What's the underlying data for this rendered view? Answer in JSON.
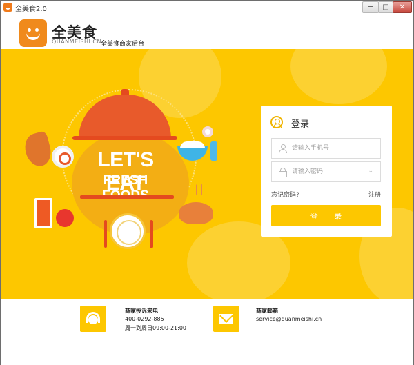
{
  "window": {
    "title": "全美食2.0",
    "min_label": "─",
    "max_label": "□",
    "close_label": "✕"
  },
  "header": {
    "logo_text": "全美食",
    "logo_sub": "QUANMEISHI.CN",
    "logo_desc": "全美食商家后台"
  },
  "banner": {
    "slogan_line1": "LET'S EAT",
    "slogan_line2": "FRESH FOODS",
    "background_color": "#fdc700"
  },
  "login": {
    "title": "登录",
    "phone_placeholder": "请输入手机号",
    "password_placeholder": "请输入密码",
    "forgot_label": "忘记密码?",
    "register_label": "注册",
    "submit_label": "登 录",
    "accent_color": "#fdc700"
  },
  "footer": {
    "complaint": {
      "label": "商家投诉来电",
      "phone": "400-0292-885",
      "hours": "周一到周日09:00-21:00",
      "icon": "headset-icon"
    },
    "email": {
      "label": "商家邮箱",
      "address": "service@quanmeishi.cn",
      "icon": "envelope-icon"
    }
  }
}
